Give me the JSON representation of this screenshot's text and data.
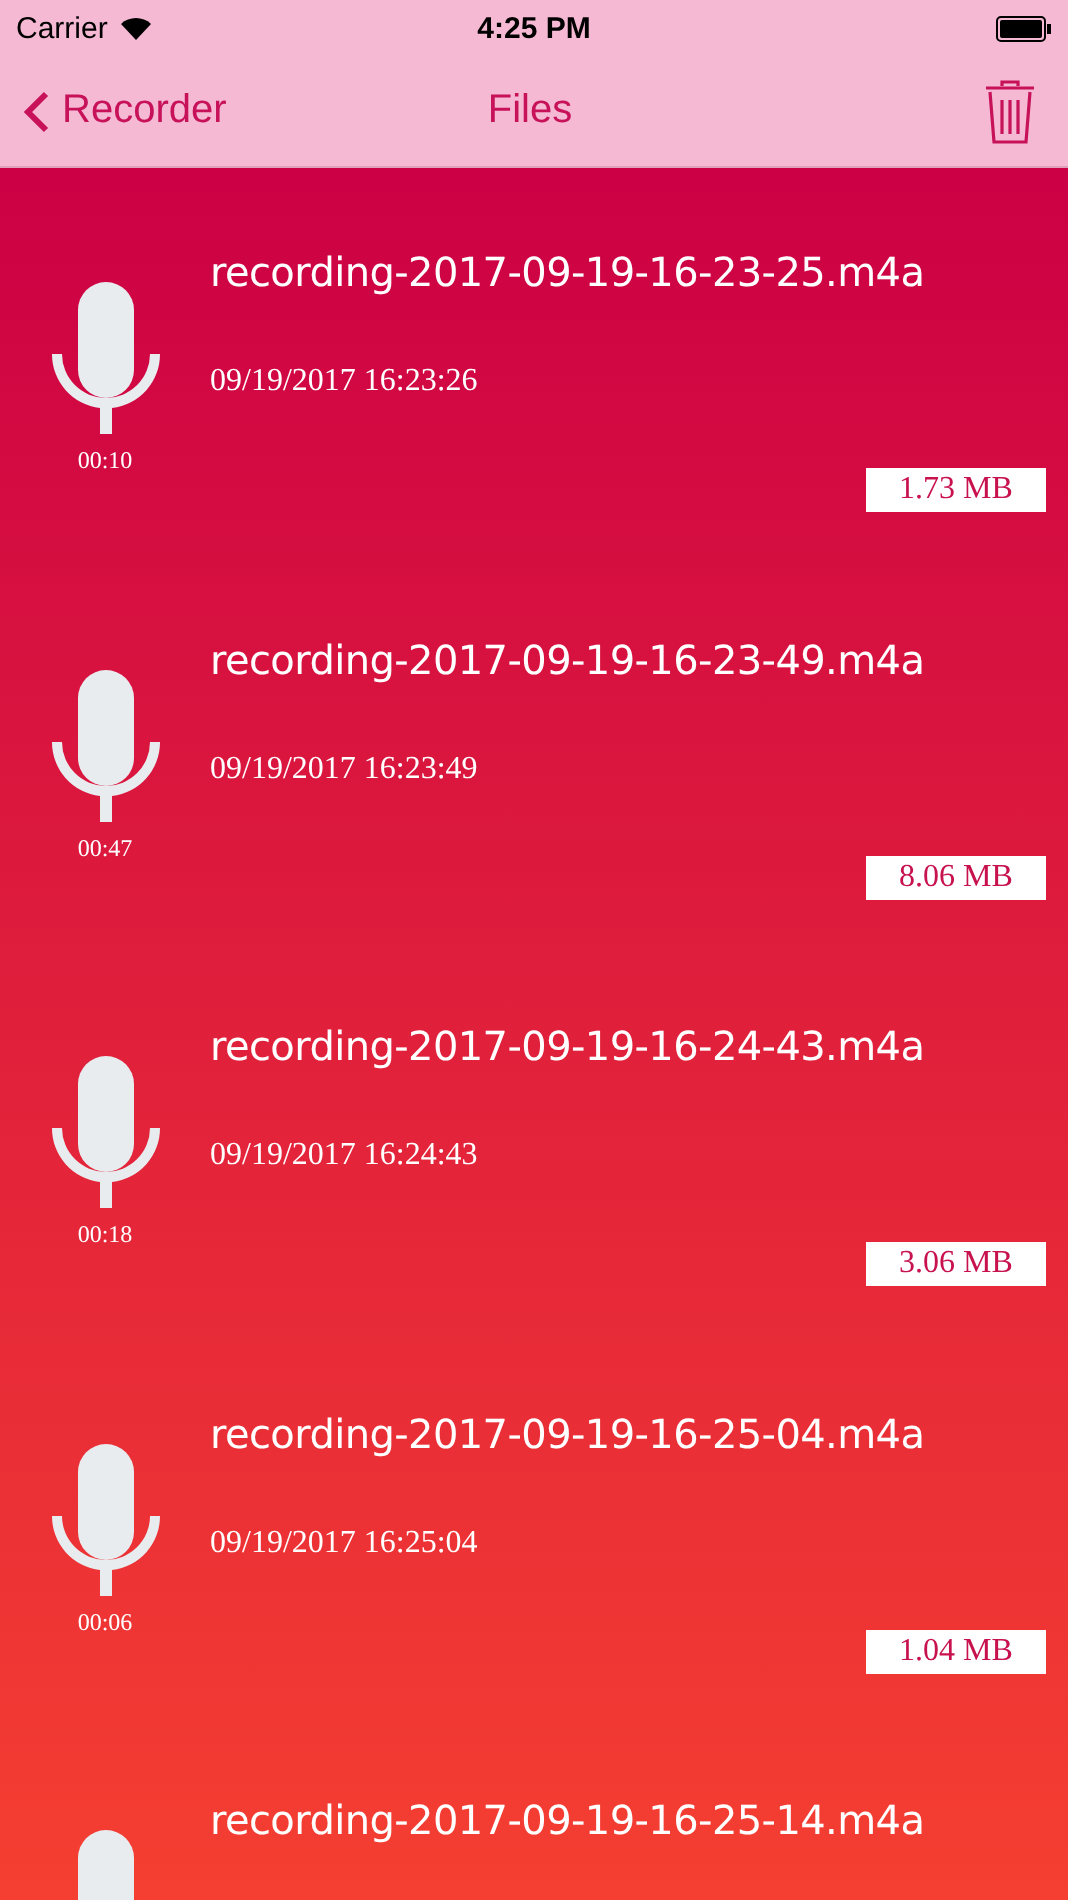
{
  "status_bar": {
    "carrier": "Carrier",
    "time": "4:25 PM"
  },
  "nav": {
    "back": "Recorder",
    "title": "Files"
  },
  "files": [
    {
      "name": "recording-2017-09-19-16-23-25.m4a",
      "date": "09/19/2017 16:23:26",
      "duration": "00:10",
      "size": "1.73 MB"
    },
    {
      "name": "recording-2017-09-19-16-23-49.m4a",
      "date": "09/19/2017 16:23:49",
      "duration": "00:47",
      "size": "8.06 MB"
    },
    {
      "name": "recording-2017-09-19-16-24-43.m4a",
      "date": "09/19/2017 16:24:43",
      "duration": "00:18",
      "size": "3.06 MB"
    },
    {
      "name": "recording-2017-09-19-16-25-04.m4a",
      "date": "09/19/2017 16:25:04",
      "duration": "00:06",
      "size": "1.04 MB"
    },
    {
      "name": "recording-2017-09-19-16-25-14.m4a"
    }
  ]
}
